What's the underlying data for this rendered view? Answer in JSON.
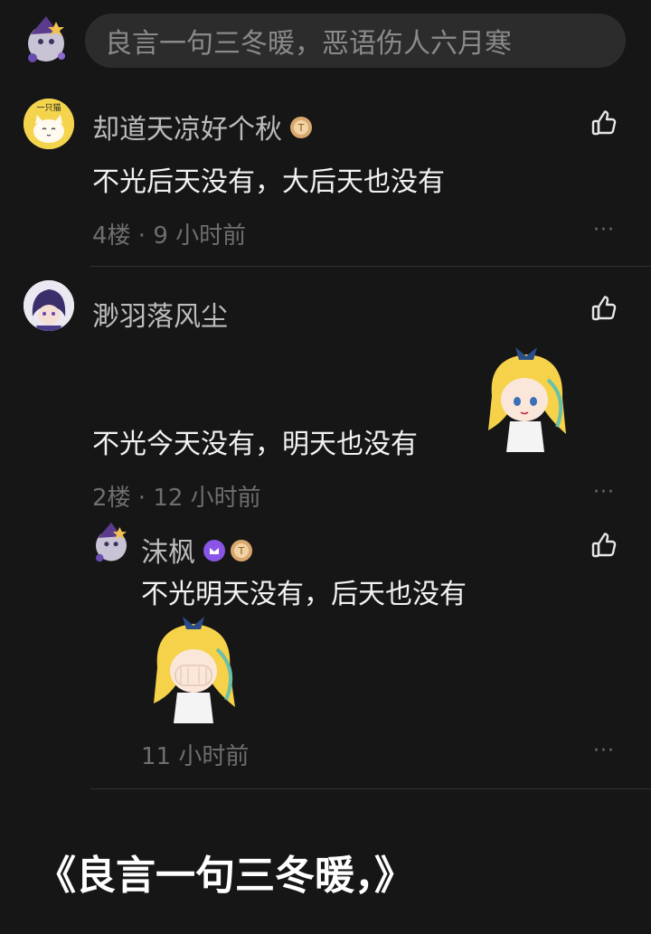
{
  "header": {
    "input_placeholder": "良言一句三冬暖，恶语伤人六月寒"
  },
  "comments": [
    {
      "username": "却道天凉好个秋",
      "text": "不光后天没有，大后天也没有",
      "meta": "4楼 · 9 小时前",
      "avatar_text": "一只猫"
    },
    {
      "username": "渺羽落风尘",
      "text": "不光今天没有，明天也没有",
      "meta": "2楼 · 12 小时前"
    }
  ],
  "reply": {
    "username": "沫枫",
    "text": "不光明天没有，后天也没有",
    "meta": "11 小时前"
  },
  "icons": {
    "like": "thumbs-up-icon",
    "more": "more-dots-icon",
    "more_glyph": "···"
  },
  "footer": {
    "caption": "《良言一句三冬暖，》"
  },
  "colors": {
    "background": "#161616",
    "input_bg": "#2c2c2c",
    "badge_gold": "#d9a86c",
    "badge_purple": "#8a54e6"
  }
}
